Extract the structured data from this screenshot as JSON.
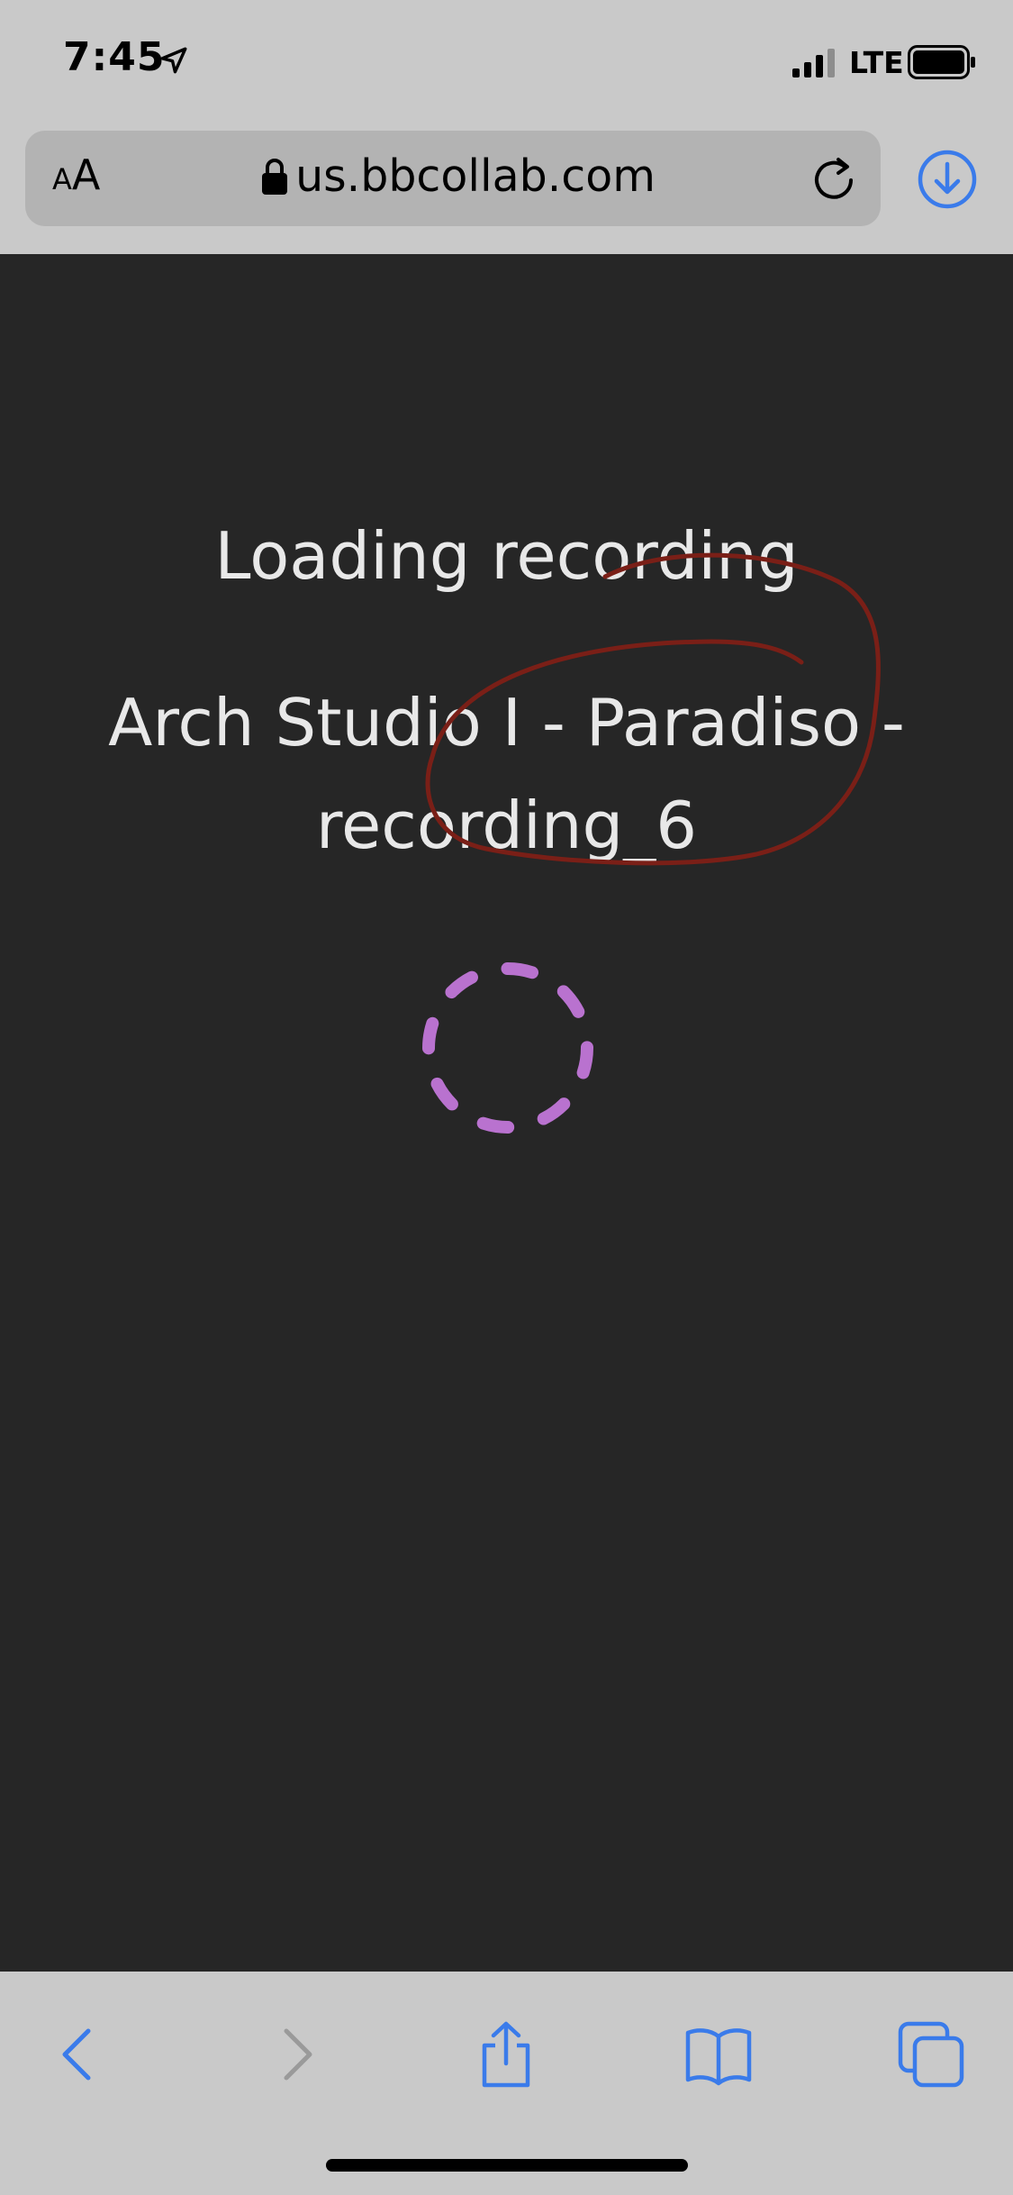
{
  "status_bar": {
    "time": "7:45",
    "network": "LTE",
    "icons": [
      "location-arrow-icon",
      "signal-bars-icon",
      "battery-icon"
    ]
  },
  "browser": {
    "text_size_label_small": "A",
    "text_size_label_large": "A",
    "url": "us.bbcollab.com",
    "icons": [
      "lock-icon",
      "reload-icon",
      "download-icon"
    ]
  },
  "content": {
    "title": "Loading recording",
    "recording_name": "Arch Studio I - Paradiso - recording_6"
  },
  "toolbar": {
    "icons": [
      "back-icon",
      "forward-icon",
      "share-icon",
      "bookmarks-icon",
      "tabs-icon"
    ]
  },
  "colors": {
    "chrome_background": "#c9c9c9",
    "page_background": "#262626",
    "accent_blue": "#3a7bea",
    "spinner_purple": "#b972cf",
    "annotation_red": "#7a1f17"
  }
}
